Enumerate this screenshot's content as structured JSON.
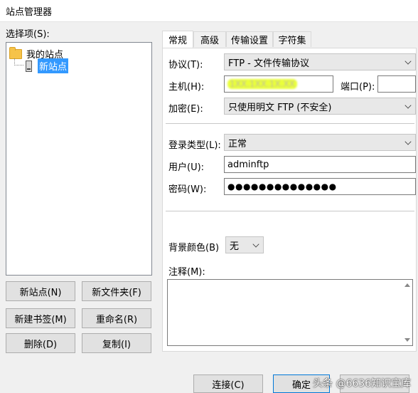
{
  "window": {
    "title": "站点管理器"
  },
  "sidebar": {
    "select_label": "选择项(S):",
    "tree": {
      "root": "我的站点",
      "child": "新站点"
    },
    "buttons": {
      "new_site": "新站点(N)",
      "new_folder": "新文件夹(F)",
      "new_bookmark": "新建书签(M)",
      "rename": "重命名(R)",
      "delete": "删除(D)",
      "copy": "复制(I)"
    }
  },
  "tabs": [
    "常规",
    "高级",
    "传输设置",
    "字符集"
  ],
  "general": {
    "protocol_label": "协议(T):",
    "protocol_value": "FTP - 文件传输协议",
    "host_label": "主机(H):",
    "host_value": "1XX.1XX.1X.XX",
    "port_label": "端口(P):",
    "port_value": "",
    "encryption_label": "加密(E):",
    "encryption_value": "只使用明文 FTP (不安全)",
    "logon_type_label": "登录类型(L):",
    "logon_type_value": "正常",
    "user_label": "用户(U):",
    "user_value": "adminftp",
    "password_label": "密码(W):",
    "password_value": "●●●●●●●●●●●●●●",
    "bg_color_label": "背景颜色(B)",
    "bg_color_value": "无",
    "comment_label": "注释(M):"
  },
  "footer": {
    "connect": "连接(C)",
    "ok": "确定",
    "watermark": "头条 @6636知识宝库"
  }
}
